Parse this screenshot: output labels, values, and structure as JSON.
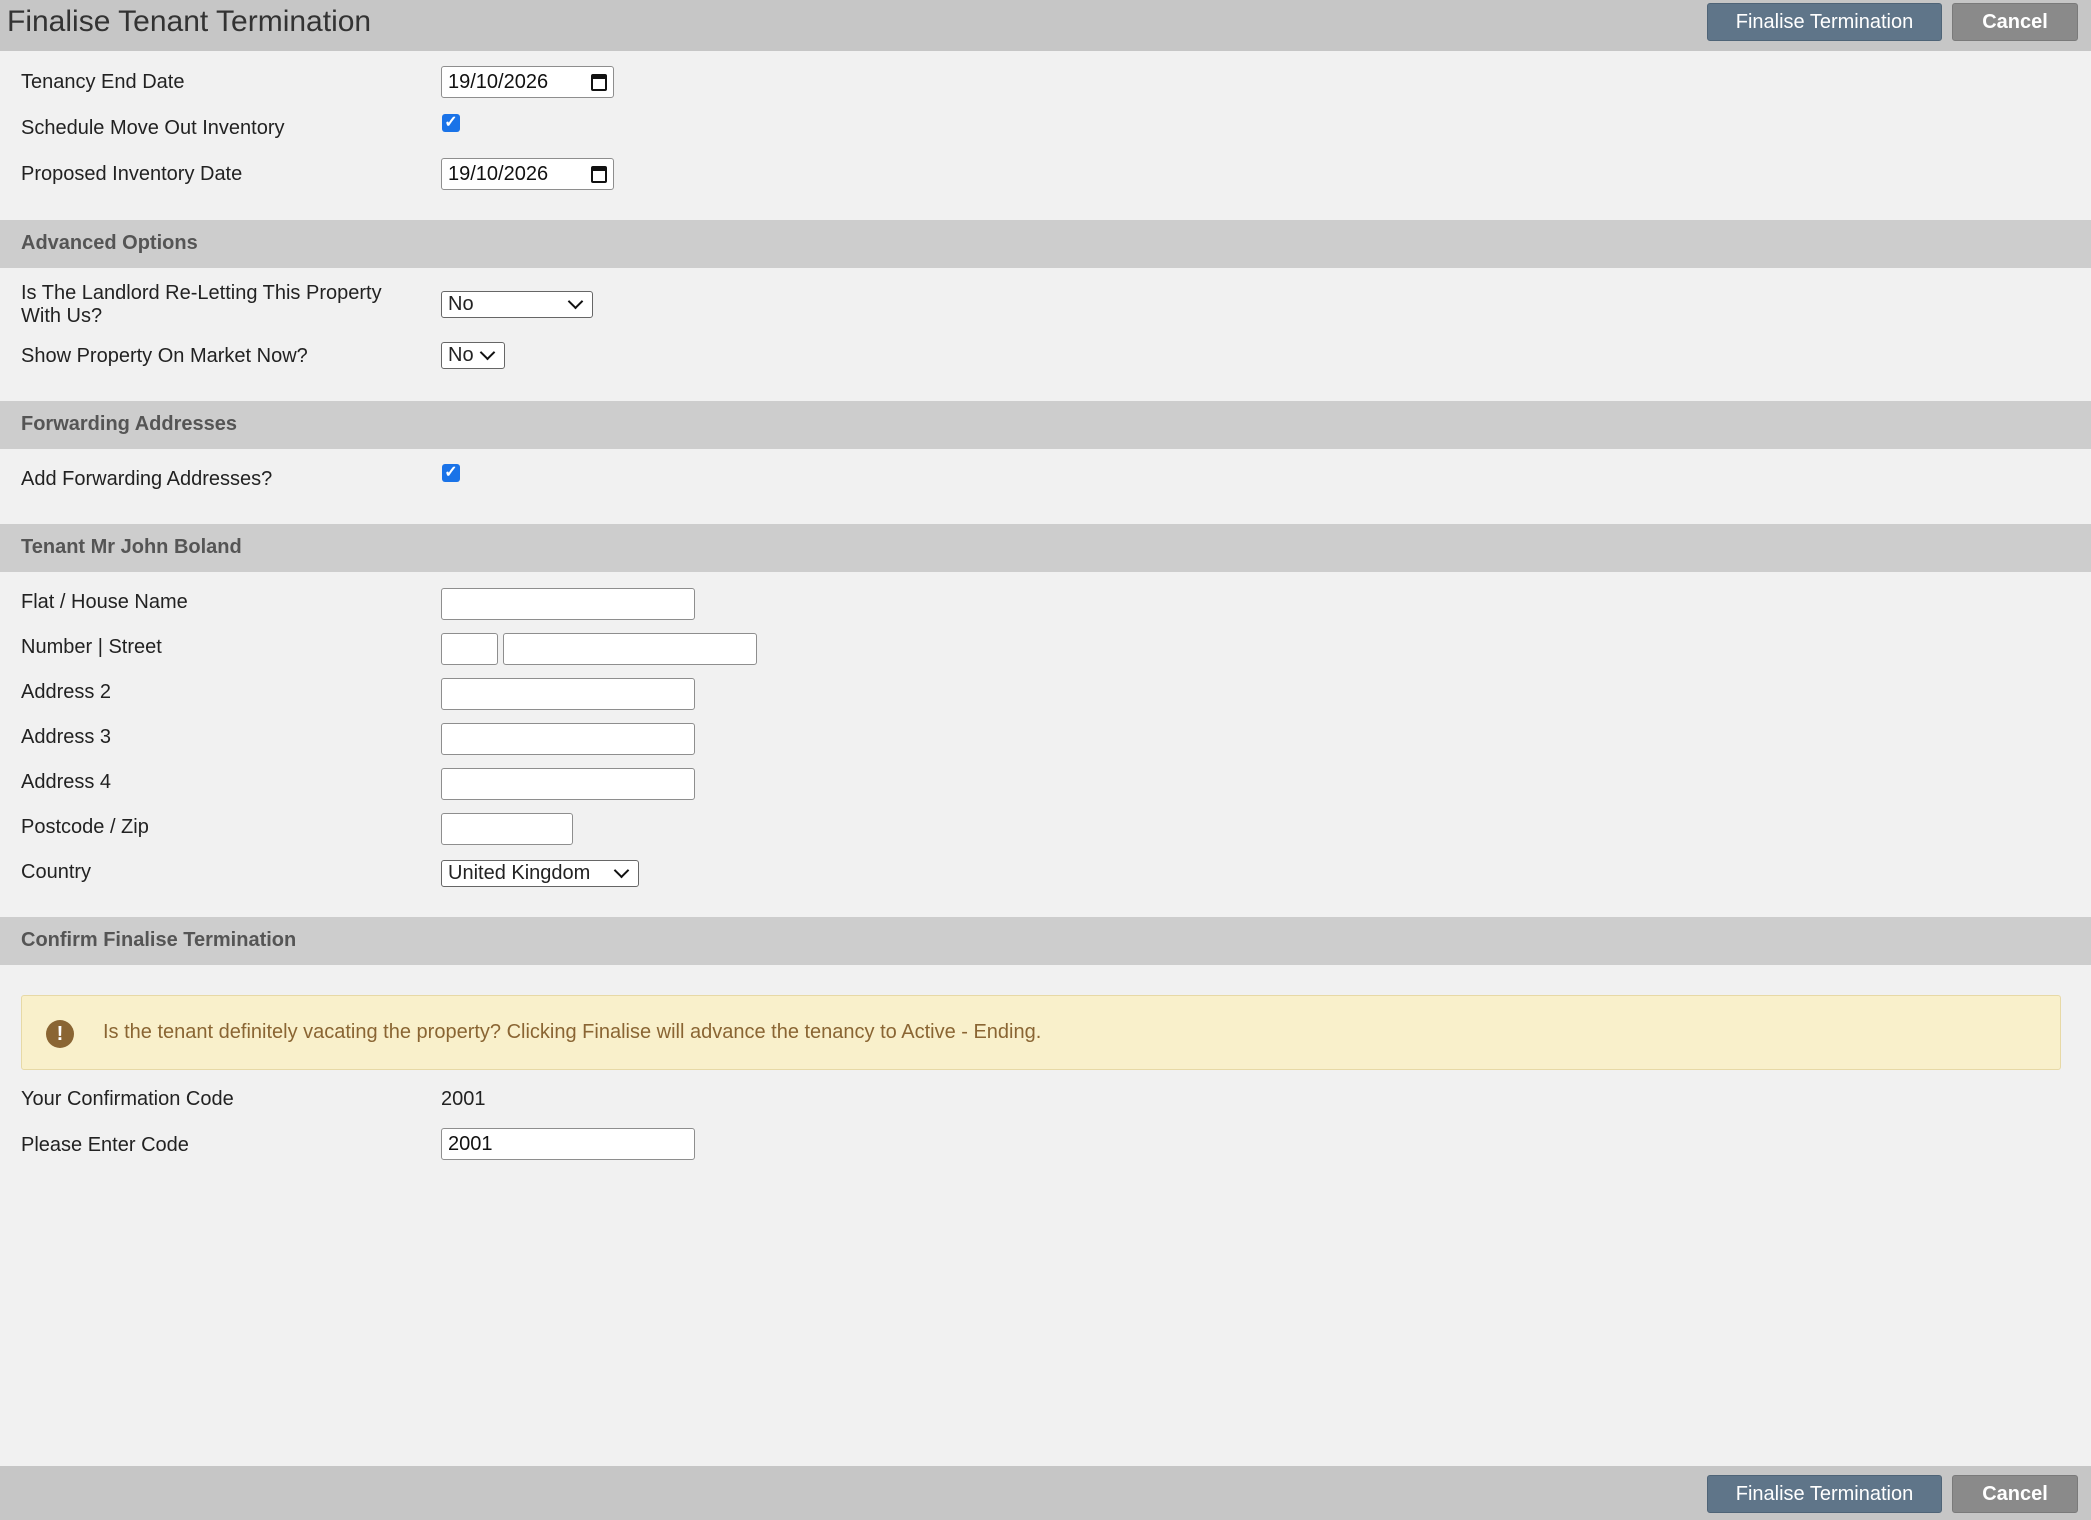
{
  "header": {
    "title": "Finalise Tenant Termination",
    "finalise_label": "Finalise Termination",
    "cancel_label": "Cancel"
  },
  "termination": {
    "tenancy_end_date_label": "Tenancy End Date",
    "tenancy_end_date_value": "19/10/2026",
    "schedule_inventory_label": "Schedule Move Out Inventory",
    "schedule_inventory_checked": true,
    "proposed_inventory_date_label": "Proposed Inventory Date",
    "proposed_inventory_date_value": "19/10/2026"
  },
  "advanced": {
    "heading": "Advanced Options",
    "reletting_label": "Is The Landlord Re-Letting This Property With Us?",
    "reletting_value": "No",
    "show_market_label": "Show Property On Market Now?",
    "show_market_value": "No"
  },
  "forwarding": {
    "heading": "Forwarding Addresses",
    "add_label": "Add Forwarding Addresses?",
    "add_checked": true
  },
  "tenant": {
    "heading": "Tenant Mr John Boland",
    "flat_label": "Flat / House Name",
    "number_street_label": "Number | Street",
    "address2_label": "Address 2",
    "address3_label": "Address 3",
    "address4_label": "Address 4",
    "postcode_label": "Postcode / Zip",
    "country_label": "Country",
    "country_value": "United Kingdom"
  },
  "confirm": {
    "heading": "Confirm Finalise Termination",
    "alert_text": "Is the tenant definitely vacating the property? Clicking Finalise will advance the tenancy to Active - Ending.",
    "your_code_label": "Your Confirmation Code",
    "your_code_value": "2001",
    "enter_code_label": "Please Enter Code",
    "enter_code_value": "2001"
  },
  "footer": {
    "finalise_label": "Finalise Termination",
    "cancel_label": "Cancel"
  },
  "colors": {
    "primary_button": "#5f7589",
    "cancel_button": "#8a8a8a",
    "checkbox_accent": "#1a73e8",
    "alert_background": "#f9f0cb",
    "alert_text": "#8a6533"
  }
}
